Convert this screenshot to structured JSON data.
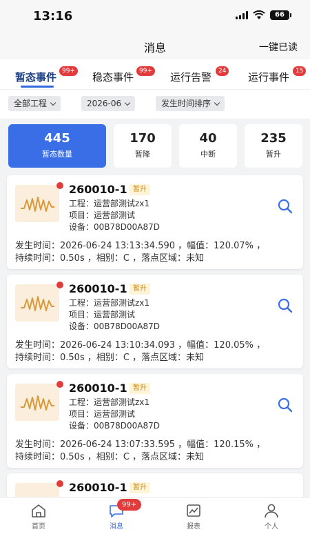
{
  "status_bar": {
    "time": "13:16",
    "battery": "66"
  },
  "nav": {
    "title": "消息",
    "action_label": "一键已读"
  },
  "tabs": [
    {
      "label": "暂态事件",
      "badge": "99+",
      "active": true
    },
    {
      "label": "稳态事件",
      "badge": "99+",
      "active": false
    },
    {
      "label": "运行告警",
      "badge": "24",
      "active": false
    },
    {
      "label": "运行事件",
      "badge": "15",
      "active": false
    }
  ],
  "filters": {
    "project": "全部工程",
    "month": "2026-06",
    "sort": "发生时间排序"
  },
  "stats": [
    {
      "value": "445",
      "label": "暂态数量",
      "active": true
    },
    {
      "value": "170",
      "label": "暂降",
      "active": false
    },
    {
      "value": "40",
      "label": "中断",
      "active": false
    },
    {
      "value": "235",
      "label": "暂升",
      "active": false
    }
  ],
  "events": [
    {
      "code": "260010-1",
      "type": "暂升",
      "project_line": "工程：运营部测试zx1",
      "item_line": "项目：运营部测试",
      "device_line": "设备：00B78D00A87D",
      "detail_line1": "发生时间：2026-06-24 13:13:34.590 ，幅值：120.07% ，",
      "detail_line2": "持续时间：0.50s ，相别：C ，落点区域：未知"
    },
    {
      "code": "260010-1",
      "type": "暂升",
      "project_line": "工程：运营部测试zx1",
      "item_line": "项目：运营部测试",
      "device_line": "设备：00B78D00A87D",
      "detail_line1": "发生时间：2026-06-24 13:10:34.093 ，幅值：120.05% ，",
      "detail_line2": "持续时间：0.50s ，相别：C ，落点区域：未知"
    },
    {
      "code": "260010-1",
      "type": "暂升",
      "project_line": "工程：运营部测试zx1",
      "item_line": "项目：运营部测试",
      "device_line": "设备：00B78D00A87D",
      "detail_line1": "发生时间：2026-06-24 13:07:33.595 ，幅值：120.15% ，",
      "detail_line2": "持续时间：0.50s ，相别：C ，落点区域：未知"
    },
    {
      "code": "260010-1",
      "type": "暂升"
    }
  ],
  "bottom_nav": [
    {
      "label": "首页",
      "icon": "home-icon",
      "active": false
    },
    {
      "label": "消息",
      "icon": "message-icon",
      "active": true,
      "badge": "99+"
    },
    {
      "label": "报表",
      "icon": "chart-icon",
      "active": false
    },
    {
      "label": "个人",
      "icon": "person-icon",
      "active": false
    }
  ],
  "colors": {
    "accent": "#3a6ee6",
    "badge": "#e23b3b",
    "tag_text": "#c98d1a",
    "tag_bg": "#fff4d8",
    "wave": "#d99a3a"
  }
}
